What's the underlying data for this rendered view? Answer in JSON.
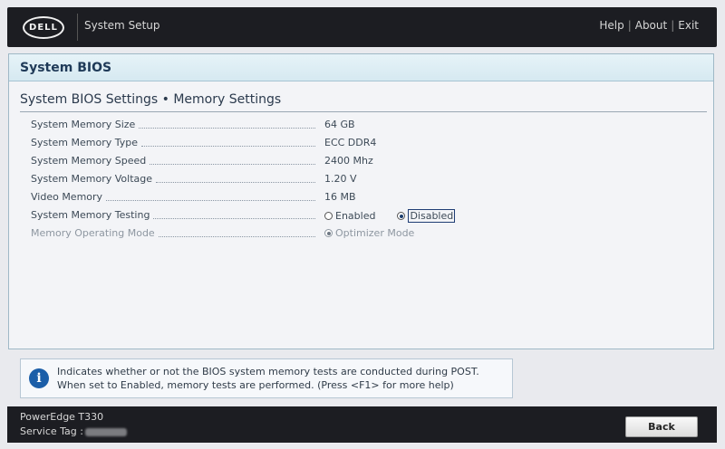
{
  "header": {
    "logo_text": "DELL",
    "app_title": "System Setup",
    "links": {
      "help": "Help",
      "about": "About",
      "exit": "Exit",
      "separator": "|"
    }
  },
  "panel": {
    "title": "System BIOS",
    "page_title": "System BIOS Settings • Memory Settings"
  },
  "settings": [
    {
      "label": "System Memory Size",
      "value": "64 GB"
    },
    {
      "label": "System Memory Type",
      "value": "ECC DDR4"
    },
    {
      "label": "System Memory Speed",
      "value": "2400 Mhz"
    },
    {
      "label": "System Memory Voltage",
      "value": "1.20 V"
    },
    {
      "label": "Video Memory",
      "value": "16 MB"
    },
    {
      "label": "System Memory Testing",
      "options": [
        "Enabled",
        "Disabled"
      ],
      "selected": "Disabled"
    },
    {
      "label": "Memory Operating Mode",
      "options": [
        "Optimizer Mode"
      ],
      "selected": "Optimizer Mode",
      "disabled": true
    }
  ],
  "help": {
    "icon": "info-icon",
    "line1": "Indicates whether or not the BIOS system memory tests are conducted during POST.",
    "line2": "When set to Enabled, memory tests are performed. (Press <F1> for more help)"
  },
  "footer": {
    "model": "PowerEdge T330",
    "service_tag_label": "Service Tag :",
    "back_label": "Back"
  }
}
